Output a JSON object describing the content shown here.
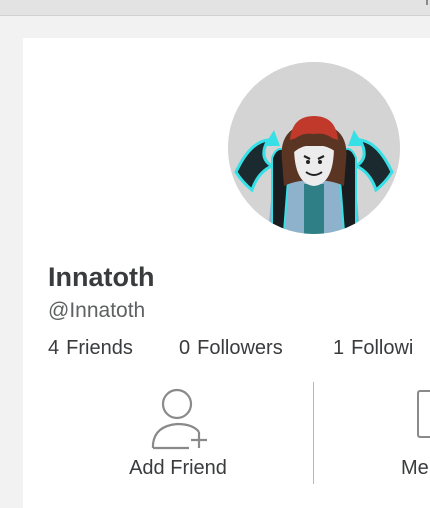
{
  "profile": {
    "display_name": "Innatoth",
    "username": "@Innatoth"
  },
  "stats": {
    "friends": {
      "count": "4",
      "label": "Friends"
    },
    "followers": {
      "count": "0",
      "label": "Followers"
    },
    "following": {
      "count": "1",
      "label": "Followi"
    }
  },
  "actions": {
    "add_friend_label": "Add Friend",
    "message_label": "Me"
  },
  "icons": {
    "add_friend": "add-friend-icon",
    "message": "message-icon"
  },
  "colors": {
    "page_bg": "#f2f2f3",
    "card_bg": "#ffffff",
    "text_primary": "#393b3d",
    "text_secondary": "#606162",
    "icon_gray": "#8a8a8c"
  }
}
